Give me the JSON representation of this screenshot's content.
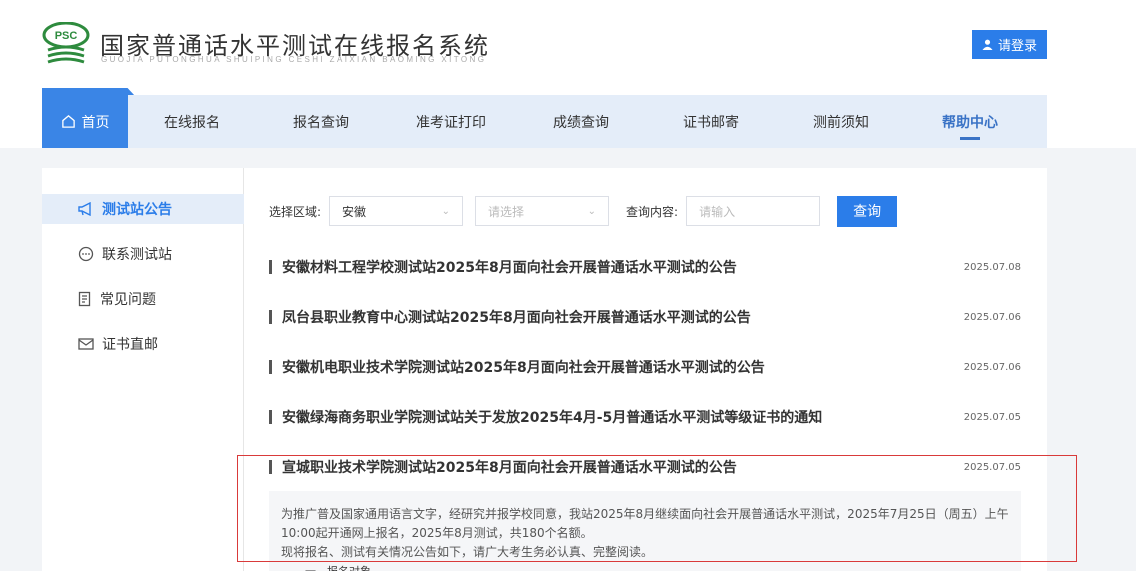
{
  "header": {
    "logo_text": "PSC",
    "site_title": "国家普通话水平测试在线报名系统",
    "site_subtitle": "GUOJIA PUTONGHUA SHUIPING CESHI ZAIXIAN BAOMING XITONG",
    "login_label": "请登录"
  },
  "nav": {
    "items": [
      {
        "label": "首页"
      },
      {
        "label": "在线报名"
      },
      {
        "label": "报名查询"
      },
      {
        "label": "准考证打印"
      },
      {
        "label": "成绩查询"
      },
      {
        "label": "证书邮寄"
      },
      {
        "label": "测前须知"
      },
      {
        "label": "帮助中心"
      }
    ]
  },
  "sidebar": {
    "items": [
      {
        "label": "测试站公告",
        "icon": "megaphone-icon"
      },
      {
        "label": "联系测试站",
        "icon": "chat-icon"
      },
      {
        "label": "常见问题",
        "icon": "document-icon"
      },
      {
        "label": "证书直邮",
        "icon": "mail-icon"
      }
    ]
  },
  "filters": {
    "region_label": "选择区域:",
    "region_value": "安徽",
    "second_placeholder": "请选择",
    "query_label": "查询内容:",
    "query_placeholder": "请输入",
    "query_button": "查询"
  },
  "notices": [
    {
      "title": "安徽材料工程学校测试站2025年8月面向社会开展普通话水平测试的公告",
      "date": "2025.07.08"
    },
    {
      "title": "凤台县职业教育中心测试站2025年8月面向社会开展普通话水平测试的公告",
      "date": "2025.07.06"
    },
    {
      "title": "安徽机电职业技术学院测试站2025年8月面向社会开展普通话水平测试的公告",
      "date": "2025.07.06"
    },
    {
      "title": "安徽绿海商务职业学院测试站关于发放2025年4月-5月普通话水平测试等级证书的通知",
      "date": "2025.07.05"
    },
    {
      "title": "宣城职业技术学院测试站2025年8月面向社会开展普通话水平测试的公告",
      "date": "2025.07.05"
    }
  ],
  "excerpt": {
    "line1": "为推广普及国家通用语言文字，经研究并报学校同意，我站2025年8月继续面向社会开展普通话水平测试，2025年7月25日（周五）上午",
    "line2": "10:00起开通网上报名，2025年8月测试，共180个名额。",
    "line3": "现将报名、测试有关情况公告如下，请广大考生务必认真、完整阅读。",
    "line4": "一、报名对象"
  },
  "colors": {
    "accent": "#2b7de9",
    "highlight": "#d93a3a"
  }
}
